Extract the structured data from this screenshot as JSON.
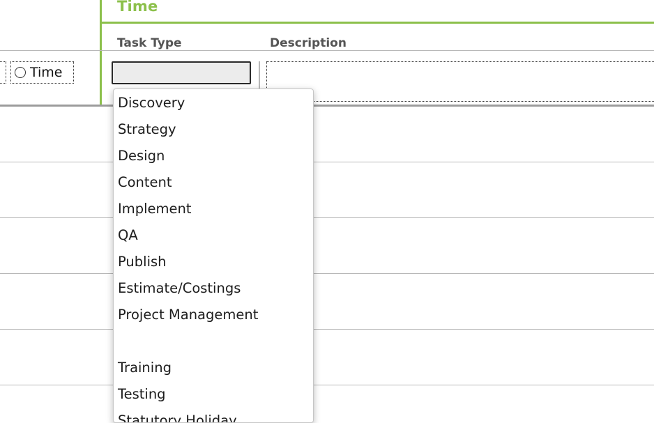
{
  "section": {
    "title": "Time",
    "columns": {
      "task_type": "Task Type",
      "description": "Description"
    }
  },
  "entry_row": {
    "radio_option_label": "Time",
    "task_type_value": "",
    "description_value": ""
  },
  "dropdown": {
    "options": [
      "Discovery",
      "Strategy",
      "Design",
      "Content",
      "Implement",
      "QA",
      "Publish",
      "Estimate/Costings",
      "Project Management",
      "",
      "Training",
      "Testing",
      "Statutory Holiday"
    ]
  },
  "colors": {
    "accent_green": "#8cc04b",
    "row_line": "#b8b8b8",
    "select_background": "#ececec"
  }
}
